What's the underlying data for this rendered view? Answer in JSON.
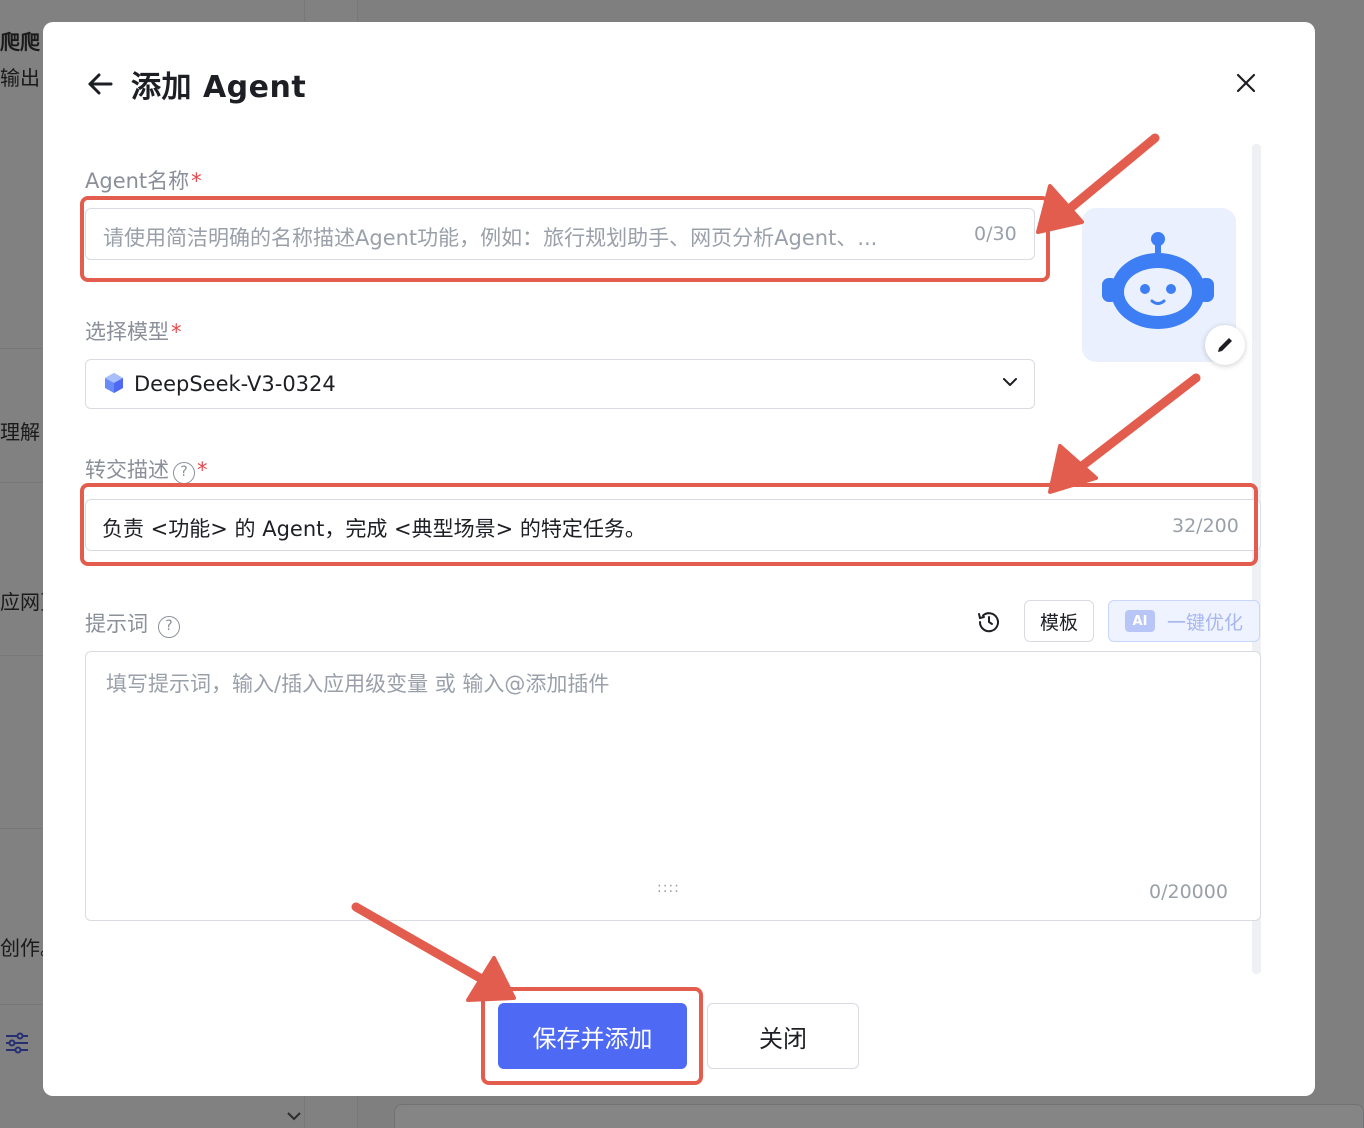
{
  "background": {
    "fragments": [
      "爬爬",
      "输出",
      "理解",
      "应网页",
      "创作。"
    ]
  },
  "modal": {
    "title": "添加 Agent",
    "agent_name": {
      "label": "Agent名称",
      "required_mark": "*",
      "placeholder": "请使用简洁明确的名称描述Agent功能，例如：旅行规划助手、网页分析Agent、...",
      "counter": "0/30"
    },
    "model": {
      "label": "选择模型",
      "required_mark": "*",
      "selected": "DeepSeek-V3-0324"
    },
    "handoff_description": {
      "label": "转交描述",
      "help": "?",
      "required_mark": "*",
      "value": "负责 <功能> 的 Agent，完成 <典型场景> 的特定任务。",
      "counter": "32/200"
    },
    "prompt": {
      "label": "提示词",
      "help": "?",
      "template_button": "模板",
      "ai_badge": "AI",
      "optimize_button": "一键优化",
      "placeholder": "填写提示词，输入/插入应用级变量 或 输入@添加插件",
      "resize_handle": "::::",
      "counter": "0/20000"
    },
    "footer": {
      "save_button": "保存并添加",
      "close_button": "关闭"
    }
  },
  "colors": {
    "primary": "#4e6af5",
    "required": "#e5484d",
    "annotation": "#e35d4f",
    "avatar_bg": "#eaf0fd",
    "robot": "#3d7ef5"
  },
  "icons": [
    "back-arrow-icon",
    "close-icon",
    "robot-avatar-icon",
    "pencil-icon",
    "cube-model-icon",
    "chevron-down-icon",
    "history-icon",
    "help-icon"
  ]
}
